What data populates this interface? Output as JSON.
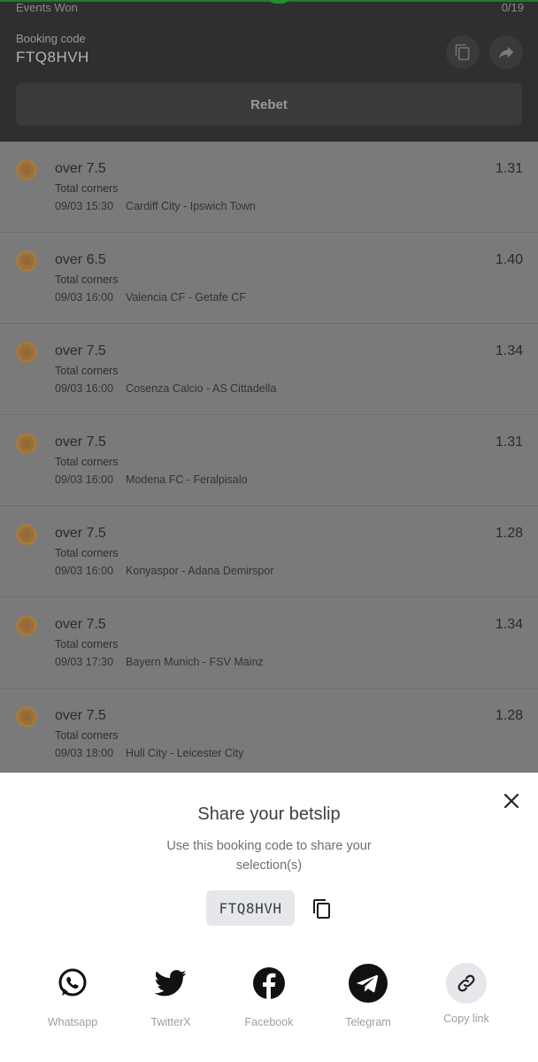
{
  "header": {
    "events_label": "Events Won",
    "events_count": "0/19",
    "booking_label": "Booking code",
    "booking_code": "FTQ8HVH",
    "rebet_label": "Rebet"
  },
  "selections": [
    {
      "pick": "over 7.5",
      "market": "Total corners",
      "time": "09/03 15:30",
      "match": "Cardiff City - Ipswich Town",
      "odds": "1.31"
    },
    {
      "pick": "over 6.5",
      "market": "Total corners",
      "time": "09/03 16:00",
      "match": "Valencia CF - Getafe CF",
      "odds": "1.40"
    },
    {
      "pick": "over 7.5",
      "market": "Total corners",
      "time": "09/03 16:00",
      "match": "Cosenza Calcio - AS Cittadella",
      "odds": "1.34"
    },
    {
      "pick": "over 7.5",
      "market": "Total corners",
      "time": "09/03 16:00",
      "match": "Modena FC - Feralpisalo",
      "odds": "1.31"
    },
    {
      "pick": "over 7.5",
      "market": "Total corners",
      "time": "09/03 16:00",
      "match": "Konyaspor - Adana Demirspor",
      "odds": "1.28"
    },
    {
      "pick": "over 7.5",
      "market": "Total corners",
      "time": "09/03 17:30",
      "match": "Bayern Munich - FSV Mainz",
      "odds": "1.34"
    },
    {
      "pick": "over 7.5",
      "market": "Total corners",
      "time": "09/03 18:00",
      "match": "Hull City - Leicester City",
      "odds": "1.28"
    }
  ],
  "share_sheet": {
    "title": "Share your betslip",
    "description": "Use this booking code to share your selection(s)",
    "code": "FTQ8HVH",
    "options": [
      {
        "label": "Whatsapp",
        "icon": "whatsapp-icon"
      },
      {
        "label": "TwitterX",
        "icon": "twitter-icon"
      },
      {
        "label": "Facebook",
        "icon": "facebook-icon"
      },
      {
        "label": "Telegram",
        "icon": "telegram-icon"
      },
      {
        "label": "Copy link",
        "icon": "link-icon"
      }
    ]
  },
  "colors": {
    "header_bg": "#2f2f2f",
    "overlay_bg": "#7a7a7a",
    "accent_green": "#1f8f32",
    "sheet_bg": "#ffffff"
  }
}
